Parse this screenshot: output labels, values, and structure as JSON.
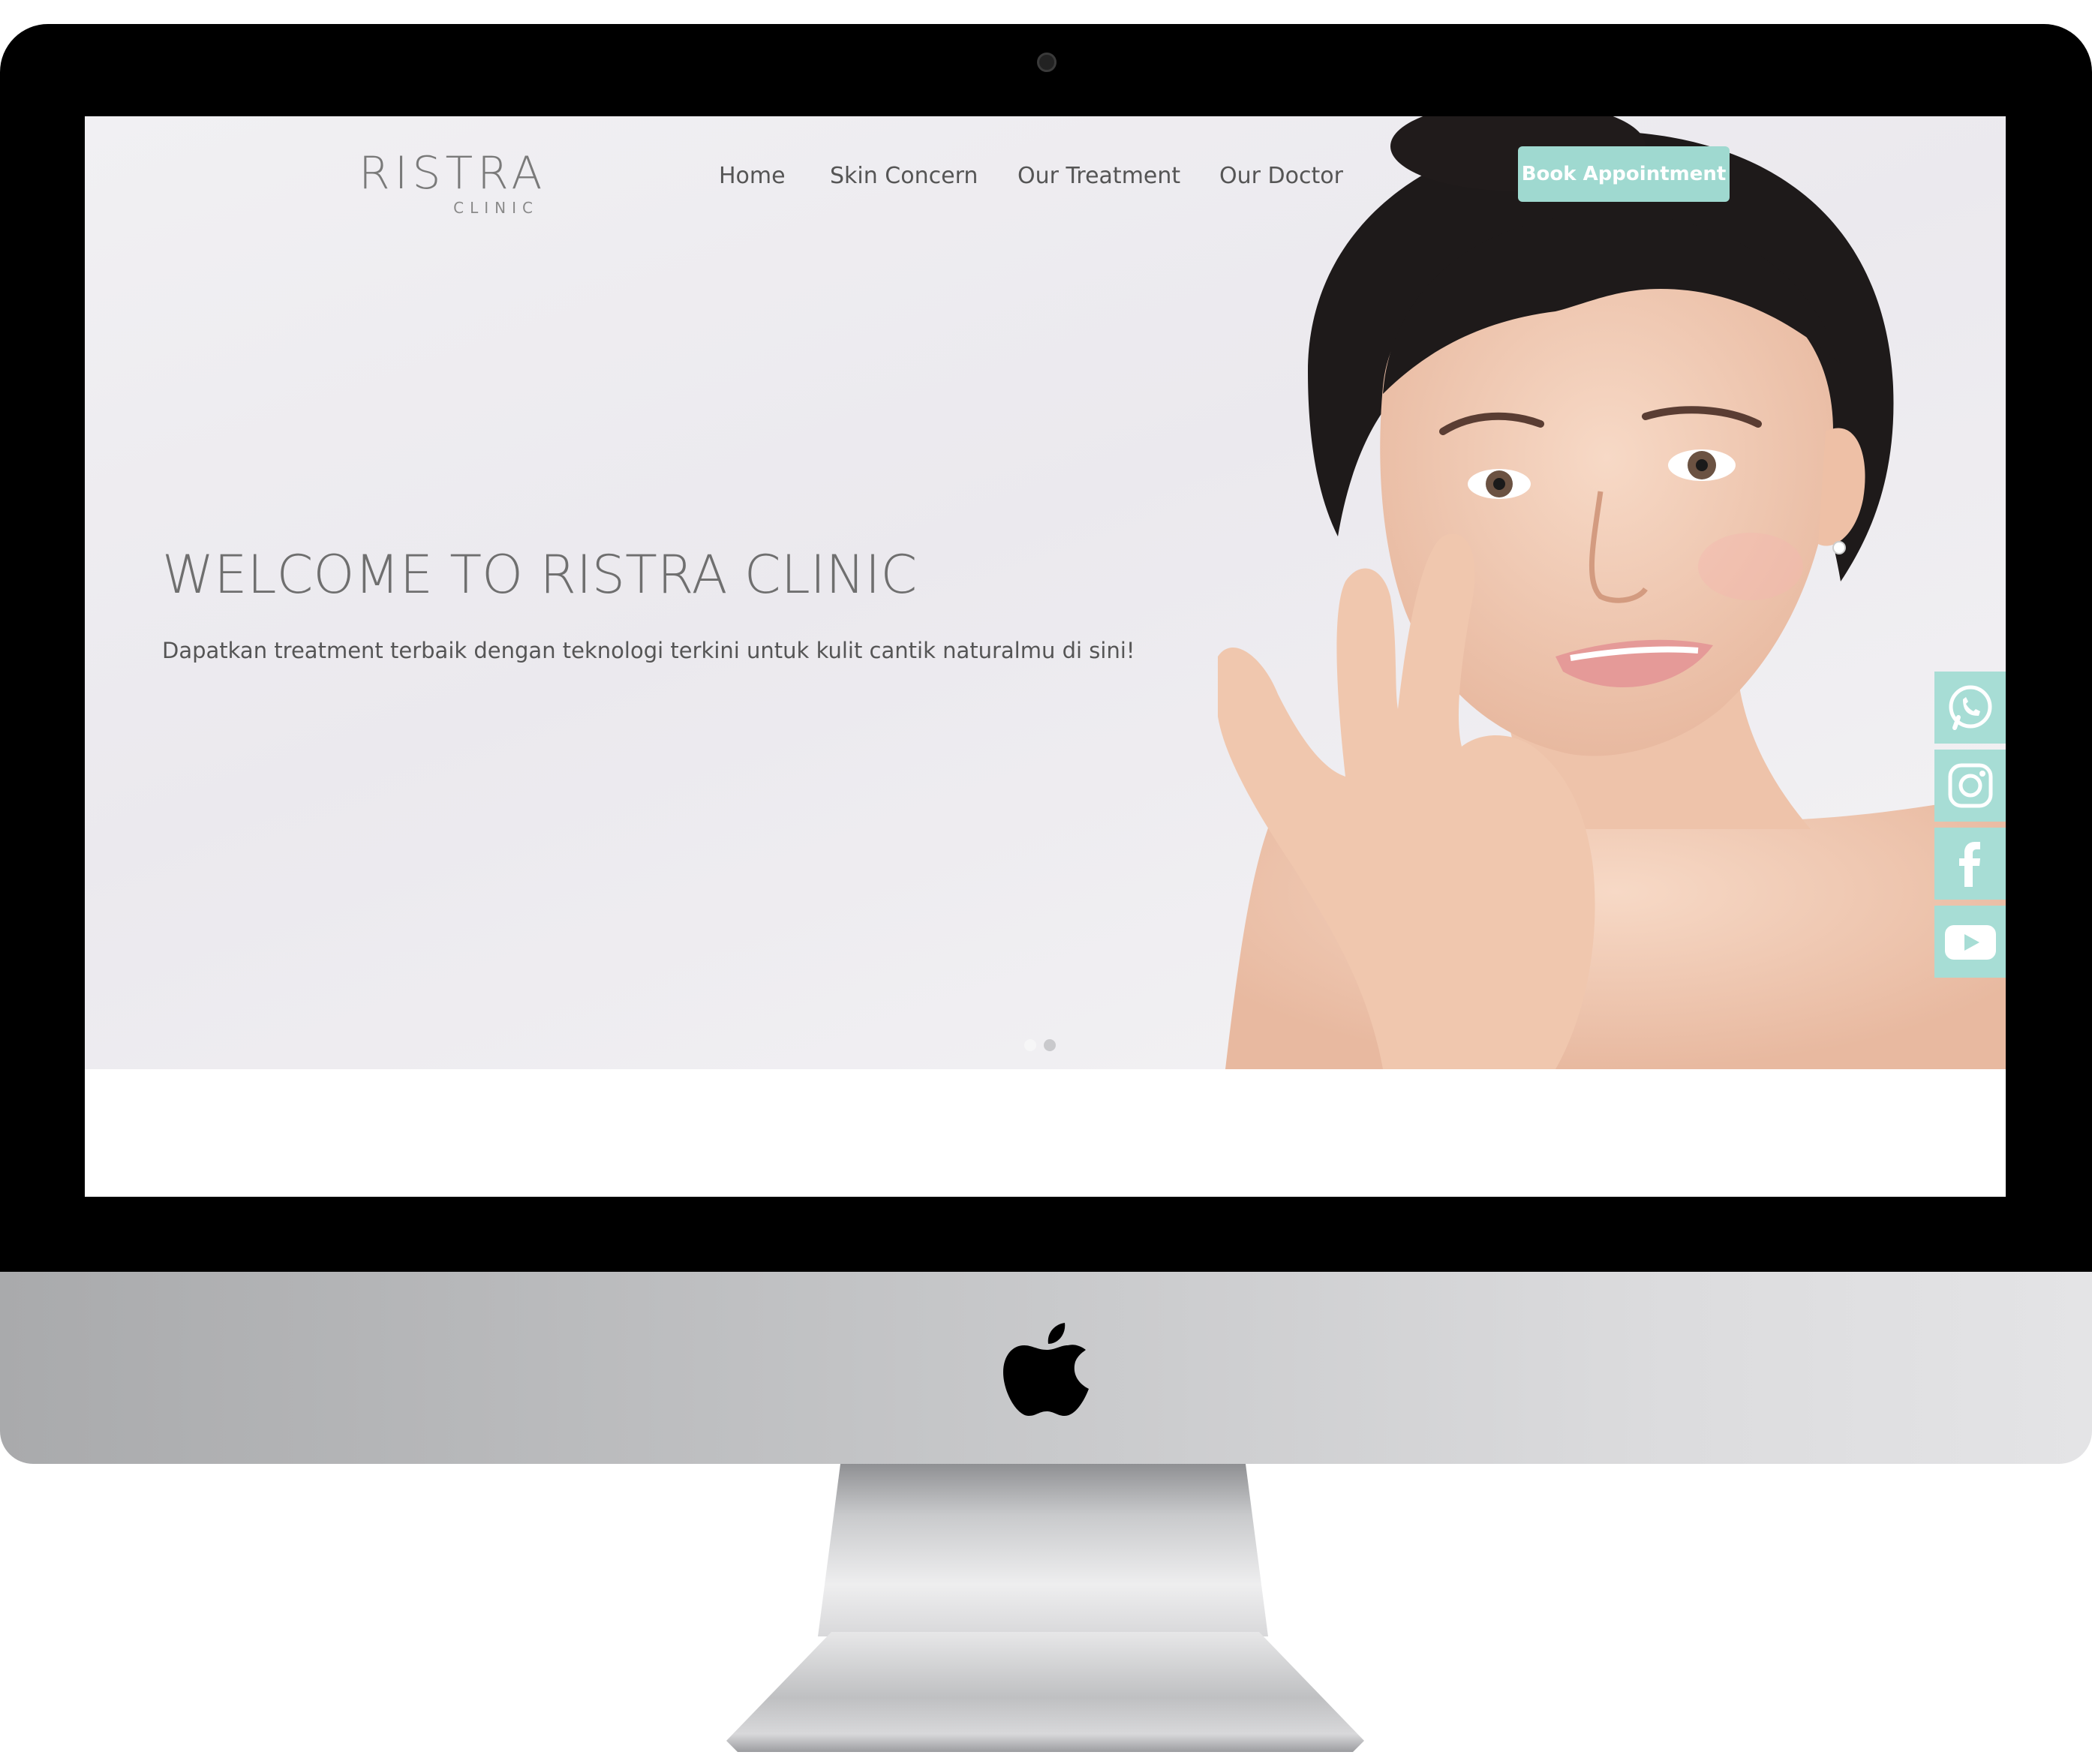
{
  "brand": {
    "name": "RISTRA",
    "tagline": "CLINIC"
  },
  "nav": {
    "items": [
      {
        "label": "Home"
      },
      {
        "label": "Skin Concern"
      },
      {
        "label": "Our Treatment"
      },
      {
        "label": "Our Doctor"
      }
    ],
    "cta_label": "Book Appointment"
  },
  "hero": {
    "title": "WELCOME TO RISTRA CLINIC",
    "subtitle": "Dapatkan treatment terbaik dengan teknologi terkini untuk kulit cantik naturalmu di sini!",
    "slides_count": 2,
    "active_slide": 1
  },
  "social": [
    {
      "icon": "whatsapp-icon"
    },
    {
      "icon": "instagram-icon"
    },
    {
      "icon": "facebook-icon"
    },
    {
      "icon": "youtube-icon"
    }
  ],
  "colors": {
    "accent": "#9fd9d0",
    "social_bg": "#a7ddd5",
    "text_gray": "#6f6f6f",
    "hero_bg": "#eeedf1"
  }
}
